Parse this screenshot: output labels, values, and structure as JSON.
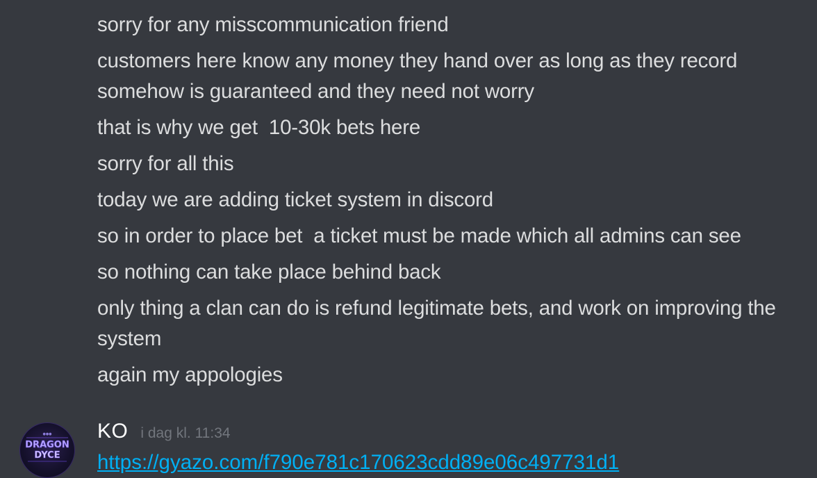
{
  "messages": [
    "sorry for any misscommunication friend",
    "customers here know any money they hand over as long as they record somehow is guaranteed and they need not worry",
    "that is why we get  10-30k bets here",
    "sorry for all this",
    "today we are adding ticket system in discord",
    "so in order to place bet  a ticket must be made which all admins can see",
    "so nothing can take place behind back",
    "only thing a clan can do is refund legitimate bets, and work on improving the system",
    "again my appologies"
  ],
  "next_message": {
    "username": "KO",
    "timestamp": "i dag kl. 11:34",
    "avatar_text_top": "DRAGON",
    "avatar_text_bottom": "DYCE",
    "link": "https://gyazo.com/f790e781c170623cdd89e06c497731d1"
  },
  "colors": {
    "background": "#36393f",
    "text": "#dcddde",
    "username": "#ffffff",
    "timestamp": "#72767d",
    "link": "#00b0f4"
  }
}
